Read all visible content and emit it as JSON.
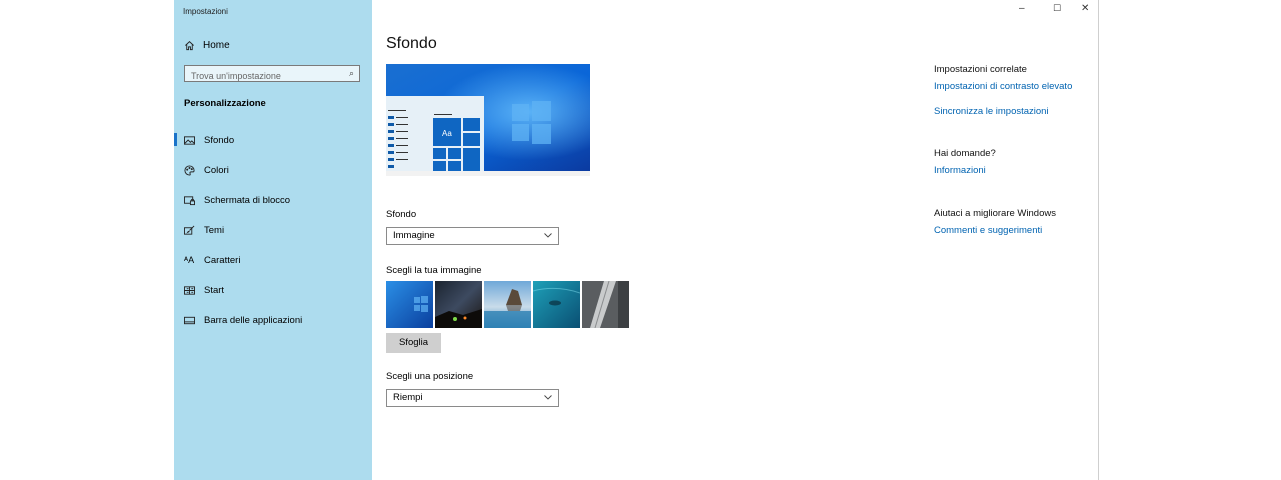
{
  "app": {
    "title": "Impostazioni"
  },
  "window_controls": {
    "minimize": "–",
    "maximize": "☐",
    "close": "✕"
  },
  "sidebar": {
    "home_label": "Home",
    "search_placeholder": "Trova un'impostazione",
    "section_title": "Personalizzazione",
    "items": [
      {
        "label": "Sfondo",
        "icon": "picture-icon",
        "selected": true
      },
      {
        "label": "Colori",
        "icon": "palette-icon"
      },
      {
        "label": "Schermata di blocco",
        "icon": "lock-screen-icon"
      },
      {
        "label": "Temi",
        "icon": "brush-icon"
      },
      {
        "label": "Caratteri",
        "icon": "font-icon"
      },
      {
        "label": "Start",
        "icon": "start-icon"
      },
      {
        "label": "Barra delle applicazioni",
        "icon": "taskbar-icon"
      }
    ]
  },
  "main": {
    "page_title": "Sfondo",
    "preview_tile_text": "Aa",
    "background_label": "Sfondo",
    "background_value": "Immagine",
    "choose_image_label": "Scegli la tua immagine",
    "browse_button": "Sfoglia",
    "position_label": "Scegli una posizione",
    "position_value": "Riempi"
  },
  "related": {
    "title": "Impostazioni correlate",
    "links": [
      "Impostazioni di contrasto elevato",
      "Sincronizza le impostazioni"
    ],
    "questions_title": "Hai domande?",
    "questions_link": "Informazioni",
    "improve_title": "Aiutaci a migliorare Windows",
    "improve_link": "Commenti e suggerimenti"
  },
  "colors": {
    "accent": "#0078d7",
    "sidebar_bg": "#addcee",
    "link": "#0063b1"
  }
}
